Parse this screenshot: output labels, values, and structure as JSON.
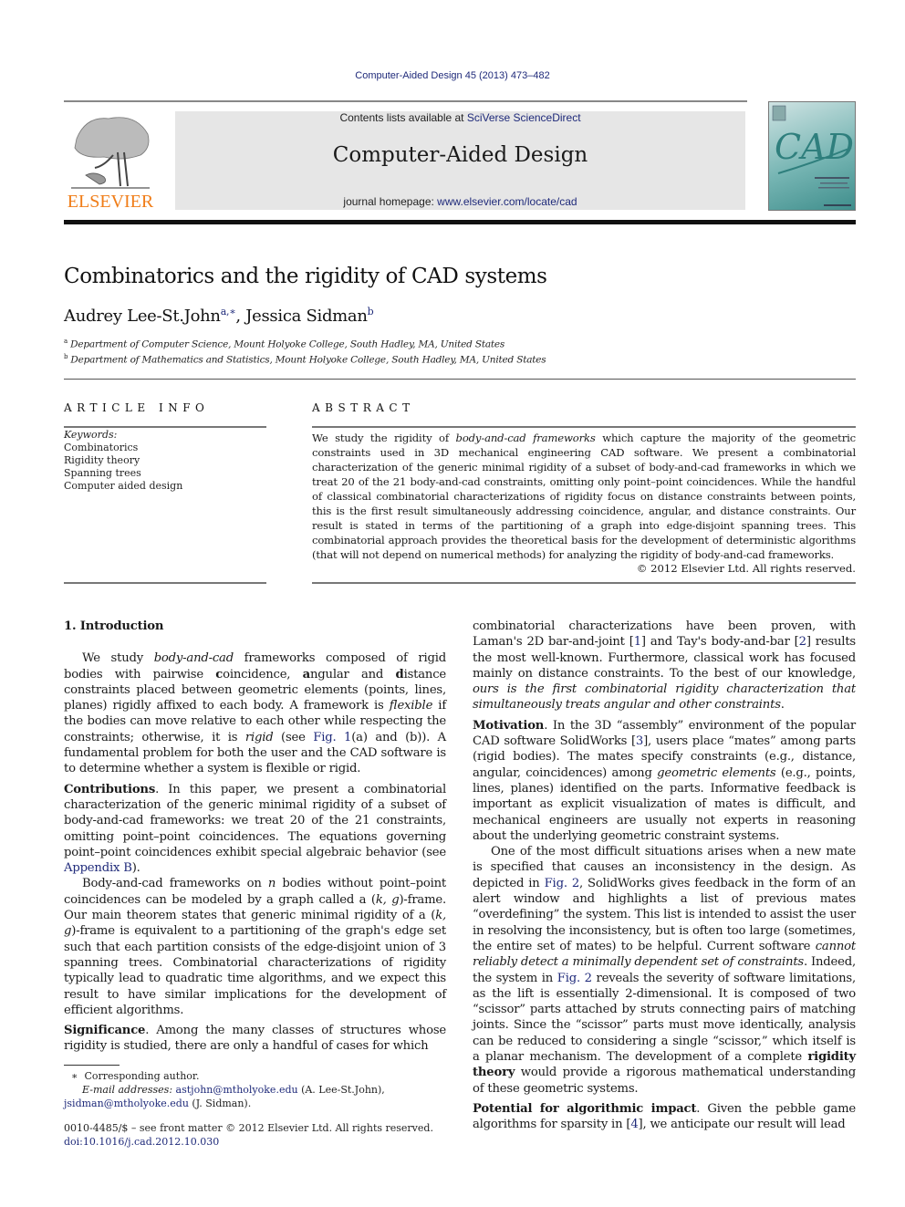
{
  "header": {
    "citation": "Computer-Aided Design 45 (2013) 473–482",
    "contents_prefix": "Contents lists available at ",
    "contents_link": "SciVerse ScienceDirect",
    "journal_name": "Computer-Aided Design",
    "homepage_prefix": "journal homepage: ",
    "homepage_link": "www.elsevier.com/locate/cad",
    "publisher_logo_text": "ELSEVIER",
    "cover_text": "CAD",
    "colors": {
      "publisher_orange": "#f07d18",
      "link_blue": "#1f2a7a",
      "banner_gray": "#e6e6e6",
      "cover_teal": "#3f8e8c"
    }
  },
  "article": {
    "title": "Combinatorics and the rigidity of CAD systems",
    "authors": [
      {
        "name": "Audrey Lee-St.John",
        "marks": "a,∗"
      },
      {
        "name": "Jessica Sidman",
        "marks": "b"
      }
    ],
    "author_separator": ", ",
    "affiliations": [
      {
        "mark": "a",
        "text": "Department of Computer Science, Mount Holyoke College, South Hadley, MA, United States"
      },
      {
        "mark": "b",
        "text": "Department of Mathematics and Statistics, Mount Holyoke College, South Hadley, MA, United States"
      }
    ]
  },
  "article_info": {
    "heading": "ARTICLE INFO",
    "keywords_label": "Keywords:",
    "keywords": [
      "Combinatorics",
      "Rigidity theory",
      "Spanning trees",
      "Computer aided design"
    ]
  },
  "abstract": {
    "heading": "ABSTRACT",
    "p1": "We study the rigidity of ",
    "p1_em": "body-and-cad frameworks",
    "p2": " which capture the majority of the geometric constraints used in 3D mechanical engineering CAD software. We present a combinatorial characterization of the generic minimal rigidity of a subset of body-and-cad frameworks in which we treat 20 of the 21 body-and-cad constraints, omitting only point–point coincidences. While the handful of classical combinatorial characterizations of rigidity focus on distance constraints between points, this is the first result simultaneously addressing coincidence, angular, and distance constraints. Our result is stated in terms of the partitioning of a graph into edge-disjoint spanning trees. This combinatorial approach provides the theoretical basis for the development of deterministic algorithms (that will not depend on numerical methods) for analyzing the rigidity of body-and-cad frameworks.",
    "copyright": "© 2012 Elsevier Ltd. All rights reserved."
  },
  "body": {
    "section_heading": "1. Introduction",
    "intro": {
      "t1": "We study ",
      "e1": "body-and-cad",
      "t2": " frameworks composed of rigid bodies with pairwise ",
      "b1": "c",
      "t3": "oincidence, ",
      "b2": "a",
      "t4": "ngular and ",
      "b3": "d",
      "t5": "istance constraints placed between geometric elements (points, lines, planes) rigidly affixed to each body. A framework is ",
      "e2": "flexible",
      "t6": " if the bodies can move relative to each other while respecting the constraints; otherwise, it is ",
      "e3": "rigid",
      "t7": " (see ",
      "l1": "Fig. 1",
      "t8": "(a) and (b)). A fundamental problem for both the user and the CAD software is to determine whether a system is flexible or rigid."
    },
    "contributions": {
      "label": "Contributions",
      "t1": ". In this paper, we present a combinatorial characterization of the generic minimal rigidity of a subset of body-and-cad frameworks: we treat 20 of the 21 constraints, omitting point–point coincidences. The equations governing point–point coincidences exhibit special algebraic behavior (see ",
      "l1": "Appendix B",
      "t2": ")."
    },
    "frames": {
      "t1": "Body-and-cad frameworks on ",
      "e1": "n",
      "t2": " bodies without point–point coincidences can be modeled by a graph called a (",
      "e2": "k, g",
      "t3": ")-frame. Our main theorem states that generic minimal rigidity of a (",
      "e3": "k, g",
      "t4": ")-frame is equivalent to a partitioning of the graph's edge set such that each partition consists of the edge-disjoint union of 3 spanning trees. Combinatorial characterizations of rigidity typically lead to quadratic time algorithms, and we expect this result to have similar implications for the development of efficient algorithms."
    },
    "significance": {
      "label": "Significance",
      "t1": ". Among the many classes of structures whose rigidity is studied, there are only a handful of cases for which"
    },
    "right_cont": {
      "t1": "combinatorial characterizations have been proven, with Laman's 2D bar-and-joint [",
      "l1": "1",
      "t2": "] and Tay's body-and-bar [",
      "l2": "2",
      "t3": "] results the most well-known. Furthermore, classical work has focused mainly on distance constraints. To the best of our knowledge, ",
      "e1": "ours is the first combinatorial rigidity characterization that simultaneously treats angular and other constraints",
      "t4": "."
    },
    "motivation": {
      "label": "Motivation",
      "t1": ". In the 3D “assembly” environment of the popular CAD software SolidWorks [",
      "l1": "3",
      "t2": "], users place “mates” among parts (rigid bodies). The mates specify constraints (e.g., distance, angular, coincidences) among ",
      "e1": "geometric elements",
      "t3": " (e.g., points, lines, planes) identified on the parts. Informative feedback is important as explicit visualization of mates is difficult, and mechanical engineers are usually not experts in reasoning about the underlying geometric constraint systems."
    },
    "difficult": {
      "t1": "One of the most difficult situations arises when a new mate is specified that causes an inconsistency in the design. As depicted in ",
      "l1": "Fig. 2",
      "t2": ", SolidWorks gives feedback in the form of an alert window and highlights a list of previous mates “overdefining” the system. This list is intended to assist the user in resolving the inconsistency, but is often too large (sometimes, the entire set of mates) to be helpful. Current software ",
      "e1": "cannot reliably detect a minimally dependent set of constraints",
      "t3": ". Indeed, the system in ",
      "l2": "Fig. 2",
      "t4": " reveals the severity of software limitations, as the lift is essentially 2-dimensional. It is composed of two “scissor” parts attached by struts connecting pairs of matching joints. Since the “scissor” parts must move identically, analysis can be reduced to considering a single “scissor,” which itself is a planar mechanism. The development of a complete ",
      "b1": "rigidity theory",
      "t5": " would provide a rigorous mathematical understanding of these geometric systems."
    },
    "potential": {
      "label": "Potential for algorithmic impact",
      "t1": ". Given the pebble game algorithms for sparsity in [",
      "l1": "4",
      "t2": "], we anticipate our result will lead"
    }
  },
  "footnotes": {
    "star": "∗",
    "corresponding": "Corresponding author.",
    "email_label": "E-mail addresses: ",
    "email1": "astjohn@mtholyoke.edu",
    "email1_owner": " (A. Lee-St.John),",
    "email2": "jsidman@mtholyoke.edu",
    "email2_owner": " (J. Sidman).",
    "front_matter": "0010-4485/$ – see front matter © 2012 Elsevier Ltd. All rights reserved.",
    "doi": "doi:10.1016/j.cad.2012.10.030"
  }
}
